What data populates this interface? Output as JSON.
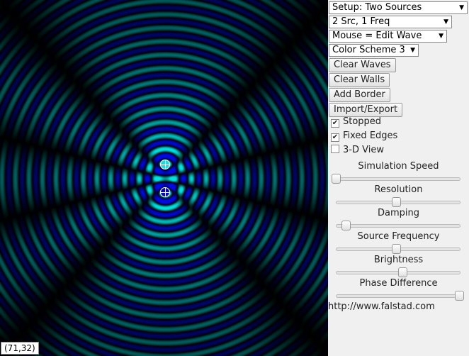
{
  "status": {
    "coords": "(71,32)"
  },
  "panel": {
    "setup": "Setup: Two Sources",
    "sources": "2 Src, 1 Freq",
    "mouse_mode": "Mouse = Edit Wave",
    "color_scheme": "Color Scheme 3",
    "clear_waves": "Clear Waves",
    "clear_walls": "Clear Walls",
    "add_border": "Add Border",
    "import_export": "Import/Export",
    "stopped": {
      "label": "Stopped",
      "checked": true
    },
    "fixed_edges": {
      "label": "Fixed Edges",
      "checked": true
    },
    "view_3d": {
      "label": "3-D View",
      "checked": false
    },
    "sliders": [
      {
        "label": "Simulation Speed",
        "value": 0.0
      },
      {
        "label": "Resolution",
        "value": 0.49
      },
      {
        "label": "Damping",
        "value": 0.08
      },
      {
        "label": "Source Frequency",
        "value": 0.49
      },
      {
        "label": "Brightness",
        "value": 0.54
      },
      {
        "label": "Phase Difference",
        "value": 1.0
      }
    ],
    "url": "http://www.falstad.com"
  },
  "colors": {
    "crest": "#2ee6e6",
    "trough": "#1a1adc",
    "background": "#000000"
  }
}
